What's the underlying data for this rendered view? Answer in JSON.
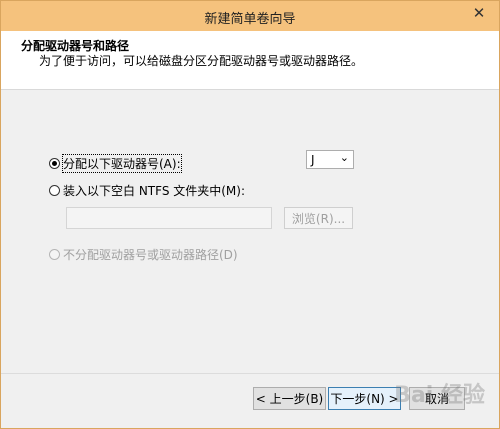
{
  "window": {
    "title": "新建简单卷向导",
    "close_glyph": "✕"
  },
  "header": {
    "title": "分配驱动器号和路径",
    "subtitle": "为了便于访问，可以给磁盘分区分配驱动器号或驱动器路径。"
  },
  "options": {
    "assign_letter": "分配以下驱动器号(A):",
    "mount_folder": "装入以下空白 NTFS 文件夹中(M):",
    "no_assign": "不分配驱动器号或驱动器路径(D)"
  },
  "drive_select": {
    "value": "J",
    "arrow": "⌄"
  },
  "folder_input": {
    "value": ""
  },
  "buttons": {
    "browse": "浏览(R)...",
    "back": "< 上一步(B)",
    "next": "下一步(N) >",
    "cancel": "取消"
  },
  "watermark": {
    "text": "Bai 经验"
  }
}
